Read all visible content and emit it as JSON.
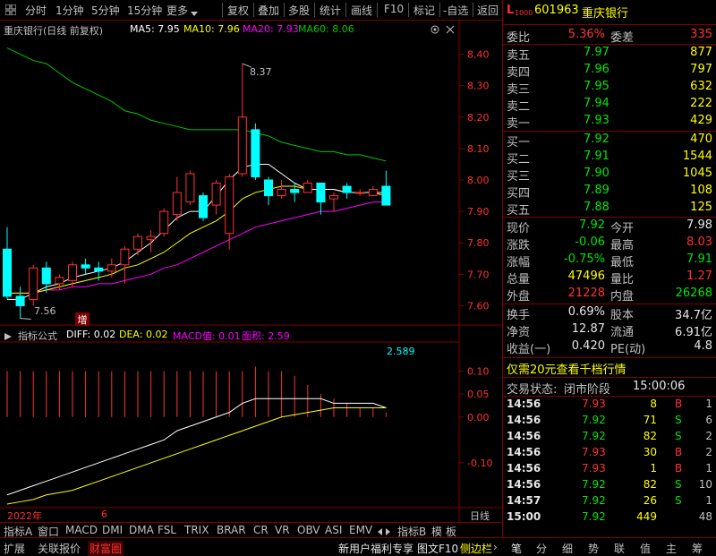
{
  "toolbar": {
    "period_items": [
      "分时",
      "1分钟",
      "5分钟",
      "15分钟",
      "更多"
    ],
    "right_items": [
      "复权",
      "叠加",
      "多股",
      "统计",
      "画线",
      "F10",
      "标记",
      "-自选",
      "返回"
    ]
  },
  "chart_header": {
    "stock_label": "重庆银行(日线 前复权)",
    "ma5": "MA5: 7.95",
    "ma10": "MA10: 7.96",
    "ma20": "MA20: 7.93",
    "ma60": "MA60: 8.06"
  },
  "indicator_header": {
    "name": "指标公式",
    "diff": "DIFF: 0.02",
    "dea": "DEA: 0.02",
    "macd": "MACD值: 0.01",
    "area": "面积: 2.59"
  },
  "colors": {
    "up": "#ff3232",
    "down": "#00ffff",
    "ma5": "#ffffff",
    "ma10": "#ffff00",
    "ma20": "#ff00ff",
    "ma60": "#00c800"
  },
  "chart_data": [
    {
      "type": "candlestick",
      "title": "重庆银行(日线 前复权)",
      "ylim": [
        7.55,
        8.45
      ],
      "yticks": [
        "8.40",
        "8.30",
        "8.20",
        "8.10",
        "8.00",
        "7.90",
        "7.80",
        "7.70",
        "7.60"
      ],
      "ytick_values": [
        8.4,
        8.3,
        8.2,
        8.1,
        8.0,
        7.9,
        7.8,
        7.7,
        7.6
      ],
      "annotations": {
        "high": "8.37",
        "low": "7.56",
        "marker": "增"
      },
      "candles": [
        {
          "o": 7.78,
          "h": 7.85,
          "l": 7.62,
          "c": 7.63
        },
        {
          "o": 7.63,
          "h": 7.66,
          "l": 7.56,
          "c": 7.6
        },
        {
          "o": 7.62,
          "h": 7.73,
          "l": 7.6,
          "c": 7.72
        },
        {
          "o": 7.72,
          "h": 7.74,
          "l": 7.64,
          "c": 7.67
        },
        {
          "o": 7.67,
          "h": 7.7,
          "l": 7.65,
          "c": 7.69
        },
        {
          "o": 7.68,
          "h": 7.74,
          "l": 7.66,
          "c": 7.73
        },
        {
          "o": 7.73,
          "h": 7.75,
          "l": 7.7,
          "c": 7.72
        },
        {
          "o": 7.72,
          "h": 7.74,
          "l": 7.68,
          "c": 7.71
        },
        {
          "o": 7.71,
          "h": 7.75,
          "l": 7.69,
          "c": 7.73
        },
        {
          "o": 7.73,
          "h": 7.79,
          "l": 7.67,
          "c": 7.78
        },
        {
          "o": 7.78,
          "h": 7.83,
          "l": 7.76,
          "c": 7.82
        },
        {
          "o": 7.81,
          "h": 7.84,
          "l": 7.77,
          "c": 7.82
        },
        {
          "o": 7.83,
          "h": 7.91,
          "l": 7.82,
          "c": 7.9
        },
        {
          "o": 7.89,
          "h": 8.01,
          "l": 7.87,
          "c": 7.96
        },
        {
          "o": 7.93,
          "h": 8.03,
          "l": 7.92,
          "c": 8.02
        },
        {
          "o": 7.95,
          "h": 7.96,
          "l": 7.87,
          "c": 7.88
        },
        {
          "o": 7.92,
          "h": 8.0,
          "l": 7.89,
          "c": 7.99
        },
        {
          "o": 7.83,
          "h": 8.02,
          "l": 7.78,
          "c": 8.01
        },
        {
          "o": 8.02,
          "h": 8.37,
          "l": 8.01,
          "c": 8.2
        },
        {
          "o": 8.16,
          "h": 8.18,
          "l": 8.0,
          "c": 8.01
        },
        {
          "o": 8.0,
          "h": 8.01,
          "l": 7.92,
          "c": 7.95
        },
        {
          "o": 7.95,
          "h": 8.0,
          "l": 7.94,
          "c": 7.97
        },
        {
          "o": 7.97,
          "h": 7.99,
          "l": 7.93,
          "c": 7.96
        },
        {
          "o": 7.96,
          "h": 8.0,
          "l": 7.96,
          "c": 7.99
        },
        {
          "o": 7.99,
          "h": 7.99,
          "l": 7.89,
          "c": 7.93
        },
        {
          "o": 7.94,
          "h": 7.96,
          "l": 7.9,
          "c": 7.95
        },
        {
          "o": 7.98,
          "h": 7.99,
          "l": 7.94,
          "c": 7.96
        },
        {
          "o": 7.96,
          "h": 7.97,
          "l": 7.95,
          "c": 7.96
        },
        {
          "o": 7.95,
          "h": 7.98,
          "l": 7.95,
          "c": 7.97
        },
        {
          "o": 7.98,
          "h": 8.03,
          "l": 7.92,
          "c": 7.92
        }
      ],
      "ma5": [
        7.62,
        7.62,
        7.64,
        7.66,
        7.67,
        7.69,
        7.7,
        7.71,
        7.72,
        7.74,
        7.77,
        7.8,
        7.84,
        7.88,
        7.9,
        7.9,
        7.95,
        8.0,
        8.04,
        8.05,
        8.05,
        8.02,
        7.99,
        7.97,
        7.97,
        7.97,
        7.96,
        7.96,
        7.96,
        7.95
      ],
      "ma10": [
        7.64,
        7.64,
        7.64,
        7.65,
        7.66,
        7.67,
        7.68,
        7.69,
        7.7,
        7.72,
        7.73,
        7.75,
        7.77,
        7.8,
        7.83,
        7.85,
        7.87,
        7.9,
        7.94,
        7.96,
        7.97,
        7.98,
        7.98,
        7.97,
        7.97,
        7.97,
        7.96,
        7.96,
        7.96,
        7.96
      ],
      "ma20": [
        7.64,
        7.64,
        7.64,
        7.65,
        7.65,
        7.66,
        7.66,
        7.67,
        7.67,
        7.68,
        7.69,
        7.7,
        7.72,
        7.73,
        7.75,
        7.77,
        7.79,
        7.81,
        7.83,
        7.85,
        7.86,
        7.87,
        7.88,
        7.89,
        7.9,
        7.9,
        7.91,
        7.92,
        7.93,
        7.93
      ],
      "ma60": [
        8.42,
        8.4,
        8.38,
        8.37,
        8.34,
        8.31,
        8.29,
        8.27,
        8.25,
        8.22,
        8.21,
        8.19,
        8.18,
        8.17,
        8.16,
        8.16,
        8.16,
        8.16,
        8.16,
        8.15,
        8.14,
        8.12,
        8.11,
        8.1,
        8.09,
        8.09,
        8.08,
        8.08,
        8.07,
        8.06
      ]
    },
    {
      "type": "macd",
      "title": "指标公式",
      "ylim": [
        -0.19,
        0.15
      ],
      "yticks": [
        "0.10",
        "0.05",
        "0.00",
        "-0.10"
      ],
      "ytick_values": [
        0.1,
        0.05,
        0.0,
        -0.1
      ],
      "annotations": {
        "area_value": "2.589"
      },
      "macd": [
        0.1,
        0.1,
        0.1,
        0.1,
        0.1,
        0.1,
        0.1,
        0.1,
        0.1,
        0.1,
        0.1,
        0.1,
        0.1,
        0.1,
        0.1,
        0.1,
        0.1,
        0.1,
        0.1,
        0.11,
        0.1,
        0.1,
        0.09,
        0.07,
        0.05,
        0.04,
        0.03,
        0.02,
        0.02,
        0.01
      ],
      "diff": [
        -0.17,
        -0.16,
        -0.15,
        -0.14,
        -0.13,
        -0.12,
        -0.11,
        -0.1,
        -0.09,
        -0.08,
        -0.07,
        -0.06,
        -0.05,
        -0.03,
        -0.02,
        -0.01,
        0.0,
        0.01,
        0.03,
        0.04,
        0.04,
        0.04,
        0.04,
        0.04,
        0.04,
        0.03,
        0.03,
        0.03,
        0.03,
        0.02
      ],
      "dea": [
        -0.19,
        -0.185,
        -0.18,
        -0.17,
        -0.165,
        -0.16,
        -0.15,
        -0.14,
        -0.13,
        -0.12,
        -0.11,
        -0.1,
        -0.09,
        -0.08,
        -0.07,
        -0.06,
        -0.05,
        -0.04,
        -0.03,
        -0.02,
        -0.01,
        0.0,
        0.005,
        0.01,
        0.015,
        0.02,
        0.02,
        0.02,
        0.02,
        0.02
      ]
    }
  ],
  "x_axis": {
    "year": "2022年",
    "month": "6",
    "right_label": "日线"
  },
  "bottom_tabs": {
    "left": [
      "指标A",
      "窗口",
      "MACD",
      "DMI",
      "DMA",
      "FSL",
      "TRIX",
      "BRAR",
      "CR",
      "VR",
      "OBV",
      "ASI",
      "EMV"
    ],
    "right": [
      "指标B",
      "模",
      "板"
    ]
  },
  "status_bar": {
    "left": [
      "扩展",
      "关联报价",
      "财富圈"
    ],
    "middle": [
      "新用户福利专享",
      "图文F10",
      "侧边栏"
    ],
    "right_tabs": [
      "笔",
      "分",
      "细",
      "势",
      "联",
      "值",
      "主",
      "筹"
    ]
  },
  "quote": {
    "level_label": "L",
    "level_sub": "1000",
    "code": "601963",
    "name": "重庆银行",
    "weibi_label": "委比",
    "weibi_value": "5.36%",
    "weicha_label": "委差",
    "weicha_value": "335",
    "asks": [
      {
        "label": "卖五",
        "price": "7.97",
        "vol": "877"
      },
      {
        "label": "卖四",
        "price": "7.96",
        "vol": "797"
      },
      {
        "label": "卖三",
        "price": "7.95",
        "vol": "632"
      },
      {
        "label": "卖二",
        "price": "7.94",
        "vol": "222"
      },
      {
        "label": "卖一",
        "price": "7.93",
        "vol": "429"
      }
    ],
    "bids": [
      {
        "label": "买一",
        "price": "7.92",
        "vol": "470"
      },
      {
        "label": "买二",
        "price": "7.91",
        "vol": "1544"
      },
      {
        "label": "买三",
        "price": "7.90",
        "vol": "1045"
      },
      {
        "label": "买四",
        "price": "7.89",
        "vol": "108"
      },
      {
        "label": "买五",
        "price": "7.88",
        "vol": "125"
      }
    ],
    "stats": [
      {
        "l1": "现价",
        "v1": "7.92",
        "c1": "green",
        "l2": "今开",
        "v2": "7.98",
        "c2": "white"
      },
      {
        "l1": "涨跌",
        "v1": "-0.06",
        "c1": "green",
        "l2": "最高",
        "v2": "8.03",
        "c2": "red"
      },
      {
        "l1": "涨幅",
        "v1": "-0.75%",
        "c1": "green",
        "l2": "最低",
        "v2": "7.91",
        "c2": "green"
      },
      {
        "l1": "总量",
        "v1": "47496",
        "c1": "yellow",
        "l2": "量比",
        "v2": "1.27",
        "c2": "red"
      },
      {
        "l1": "外盘",
        "v1": "21228",
        "c1": "red",
        "l2": "内盘",
        "v2": "26268",
        "c2": "green"
      }
    ],
    "stats2": [
      {
        "l1": "换手",
        "v1": "0.69%",
        "l2": "股本",
        "v2": "34.7亿"
      },
      {
        "l1": "净资",
        "v1": "12.87",
        "l2": "流通",
        "v2": "6.91亿"
      },
      {
        "l1": "收益(一)",
        "v1": "0.420",
        "l2": "PE(动)",
        "v2": "4.8"
      }
    ],
    "promo": "仅需20元查看千档行情",
    "trade_state_label": "交易状态:",
    "trade_state_value": "闭市阶段",
    "trade_state_time": "15:00:06",
    "ticks": [
      {
        "t": "14:56",
        "p": "7.93",
        "pc": "red",
        "v": "8",
        "s": "B",
        "n": "1"
      },
      {
        "t": "14:56",
        "p": "7.92",
        "pc": "green",
        "v": "71",
        "s": "S",
        "n": "6"
      },
      {
        "t": "14:56",
        "p": "7.92",
        "pc": "green",
        "v": "82",
        "s": "S",
        "n": "2"
      },
      {
        "t": "14:56",
        "p": "7.93",
        "pc": "red",
        "v": "30",
        "s": "B",
        "n": "2"
      },
      {
        "t": "14:56",
        "p": "7.93",
        "pc": "red",
        "v": "1",
        "s": "B",
        "n": "1"
      },
      {
        "t": "14:56",
        "p": "7.92",
        "pc": "green",
        "v": "82",
        "s": "S",
        "n": "10"
      },
      {
        "t": "14:57",
        "p": "7.92",
        "pc": "green",
        "v": "26",
        "s": "S",
        "n": "1"
      },
      {
        "t": "15:00",
        "p": "7.92",
        "pc": "green",
        "v": "449",
        "s": "",
        "n": "48"
      }
    ]
  }
}
